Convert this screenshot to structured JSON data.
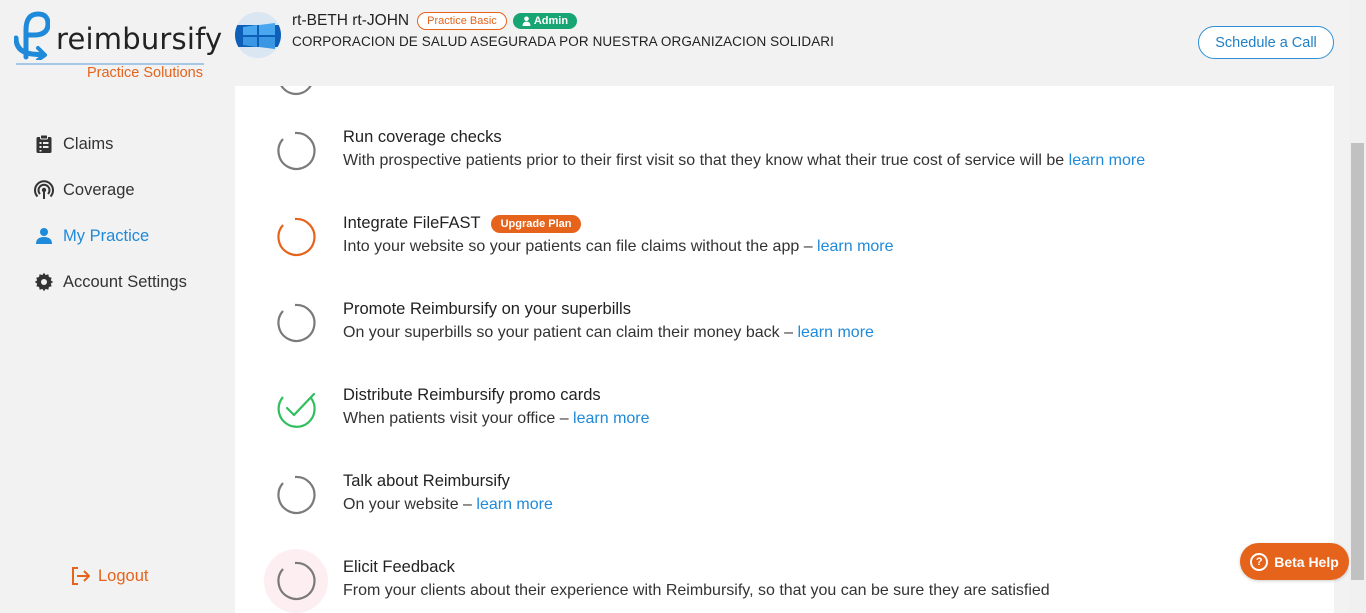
{
  "brand": {
    "name": "reimbursify",
    "subtitle": "Practice Solutions",
    "accent": "#e5631b",
    "primary": "#1f8ad9"
  },
  "sidebar": {
    "items": [
      {
        "label": "Claims",
        "icon": "clipboard-icon",
        "active": false
      },
      {
        "label": "Coverage",
        "icon": "coverage-signal-icon",
        "active": false
      },
      {
        "label": "My Practice",
        "icon": "person-icon",
        "active": true
      },
      {
        "label": "Account Settings",
        "icon": "gear-icon",
        "active": false
      }
    ],
    "logout_label": "Logout"
  },
  "header": {
    "user_name": "rt-BETH rt-JOHN",
    "plan_badge": "Practice Basic",
    "role_badge": "Admin",
    "org_name": "CORPORACION DE SALUD ASEGURADA POR NUESTRA ORGANIZACION SOLIDARI",
    "schedule_button": "Schedule a Call"
  },
  "tasks": [
    {
      "title": "Run coverage checks",
      "desc": "With prospective patients prior to their first visit so that they know what their true cost of service will be",
      "link": "learn more",
      "status": "pending",
      "badge": ""
    },
    {
      "title": "Integrate FileFAST",
      "desc": "Into your website so your patients can file claims without the app –",
      "link": "learn more",
      "status": "locked",
      "badge": "Upgrade Plan"
    },
    {
      "title": "Promote Reimbursify on your superbills",
      "desc": "On your superbills so your patient can claim their money back –",
      "link": "learn more",
      "status": "pending",
      "badge": ""
    },
    {
      "title": "Distribute Reimbursify promo cards",
      "desc": "When patients visit your office –",
      "link": "learn more",
      "status": "done",
      "badge": ""
    },
    {
      "title": "Talk about Reimbursify",
      "desc": "On your website –",
      "link": "learn more",
      "status": "pending",
      "badge": ""
    },
    {
      "title": "Elicit Feedback",
      "desc": "From your clients about their experience with Reimbursify, so that you can be sure they are satisfied",
      "link": "",
      "status": "highlighted",
      "badge": ""
    }
  ],
  "beta_help": "Beta Help"
}
